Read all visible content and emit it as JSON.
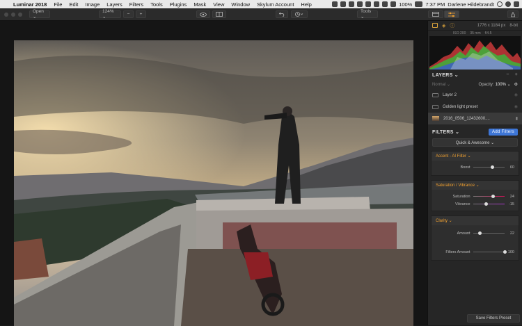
{
  "menubar": {
    "app": "Luminar 2018",
    "items": [
      "File",
      "Edit",
      "Image",
      "Layers",
      "Filters",
      "Tools",
      "Plugins",
      "Mask",
      "View",
      "Window",
      "Skylum Account",
      "Help"
    ],
    "battery": "100%",
    "time": "7:37 PM",
    "user": "Darlene Hildebrandt"
  },
  "toolbar": {
    "open": "Open ⌄",
    "zoom": "124% ⌄",
    "minus": "−",
    "plus": "+",
    "tools": "Tools ⌄"
  },
  "panel": {
    "dimensions": "1776 x 1184 px",
    "bitdepth": "8-bit",
    "exif": [
      "ISO 200",
      "35 mm",
      "f/4.5"
    ],
    "layers_title": "LAYERS ⌄",
    "blend": "Normal ⌄",
    "opacity_label": "Opacity:",
    "opacity_value": "100% ⌄",
    "layers": [
      "Layer 2",
      "Golden light preset",
      "2016_0506_12432600...."
    ],
    "filters_title": "FILTERS ⌄",
    "add_filters": "Add Filters",
    "quick": "Quick & Awesome ⌄",
    "filters": [
      {
        "title": "Accent - AI Filter ⌄",
        "sliders": [
          {
            "label": "Boost",
            "value": "60",
            "level": 0.6
          }
        ]
      },
      {
        "title": "Saturation / Vibrance ⌄",
        "sliders": [
          {
            "label": "Saturation",
            "value": "24",
            "level": 0.62
          },
          {
            "label": "Vibrance",
            "value": "-15",
            "level": 0.42
          }
        ]
      },
      {
        "title": "Clarity ⌄",
        "sliders": [
          {
            "label": "Amount",
            "value": "22",
            "level": 0.22
          },
          {
            "label": "Filters Amount",
            "value": "100",
            "level": 1.0
          }
        ]
      }
    ],
    "save_preset": "Save Filters Preset"
  },
  "colors": {
    "accent": "#f0a030",
    "button_blue": "#3e76d6"
  }
}
